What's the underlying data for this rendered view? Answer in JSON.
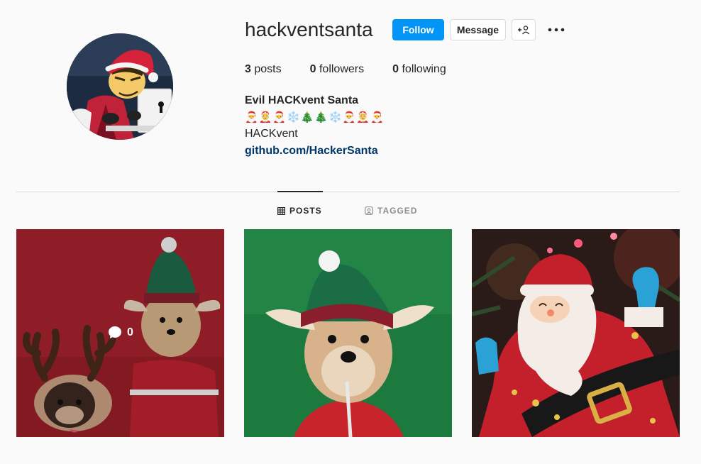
{
  "profile": {
    "username": "hackventsanta",
    "follow_label": "Follow",
    "message_label": "Message",
    "stats": {
      "posts_count": "3",
      "posts_label": "posts",
      "followers_count": "0",
      "followers_label": "followers",
      "following_count": "0",
      "following_label": "following"
    },
    "bio": {
      "name": "Evil HACKvent Santa",
      "emoji_line": "🎅🤶🎅❄️🎄🎄❄️🎅🤶🎅",
      "text": "HACKvent",
      "link": "github.com/HackerSanta"
    }
  },
  "tabs": [
    {
      "label": "POSTS",
      "icon": "grid-icon",
      "active": true
    },
    {
      "label": "TAGGED",
      "icon": "tag-user-icon",
      "active": false
    }
  ],
  "posts": [
    {
      "subject": "dogs-reindeer-elf",
      "hover_comment_count": "0"
    },
    {
      "subject": "dog-elf-hat"
    },
    {
      "subject": "santa-ornament"
    }
  ],
  "colors": {
    "accent": "#0095f6",
    "link": "#00376b",
    "muted": "#8e8e8e"
  }
}
